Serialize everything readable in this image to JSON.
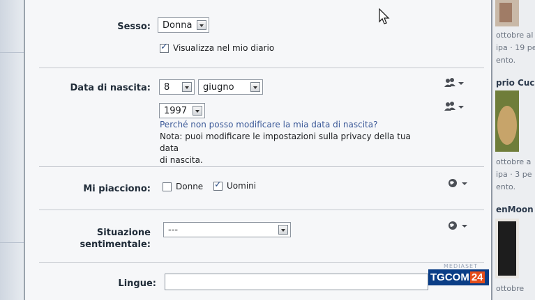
{
  "form": {
    "gender_label": "Sesso:",
    "gender_value": "Donna",
    "show_in_diary_label": "Visualizza nel mio diario",
    "show_in_diary_checked": true,
    "birth_label": "Data di nascita:",
    "birth_day": "8",
    "birth_month": "giugno",
    "birth_year": "1997",
    "birth_question": "Perché non posso modificare la mia data di nascita?",
    "birth_note_line1": "Nota: puoi modificare le impostazioni sulla privacy della tua data",
    "birth_note_line2": "di nascita.",
    "likes_label": "Mi piacciono:",
    "likes_women_label": "Donne",
    "likes_women_checked": false,
    "likes_men_label": "Uomini",
    "likes_men_checked": true,
    "relationship_label_line1": "Situazione",
    "relationship_label_line2": "sentimentale:",
    "relationship_value": "---",
    "languages_label": "Lingue:",
    "languages_value": ""
  },
  "privacy_icons": [
    "friends-privacy-icon",
    "friends-privacy-icon",
    "globe-privacy-icon",
    "globe-privacy-icon"
  ],
  "side_feed": {
    "item1_line1": "ottobre al",
    "item1_line2": "ipa · 19 pe",
    "item1_line3": "ento.",
    "item2_title": "prio Cucir",
    "item2_line1": "ottobre a",
    "item2_line2": "ipa · 3 pe",
    "item2_line3": "ento.",
    "item3_title": "enMoon",
    "item3_line1": "ottobre"
  },
  "watermark": {
    "brand": "TGCOM",
    "number": "24",
    "small": "MEDIASET"
  }
}
